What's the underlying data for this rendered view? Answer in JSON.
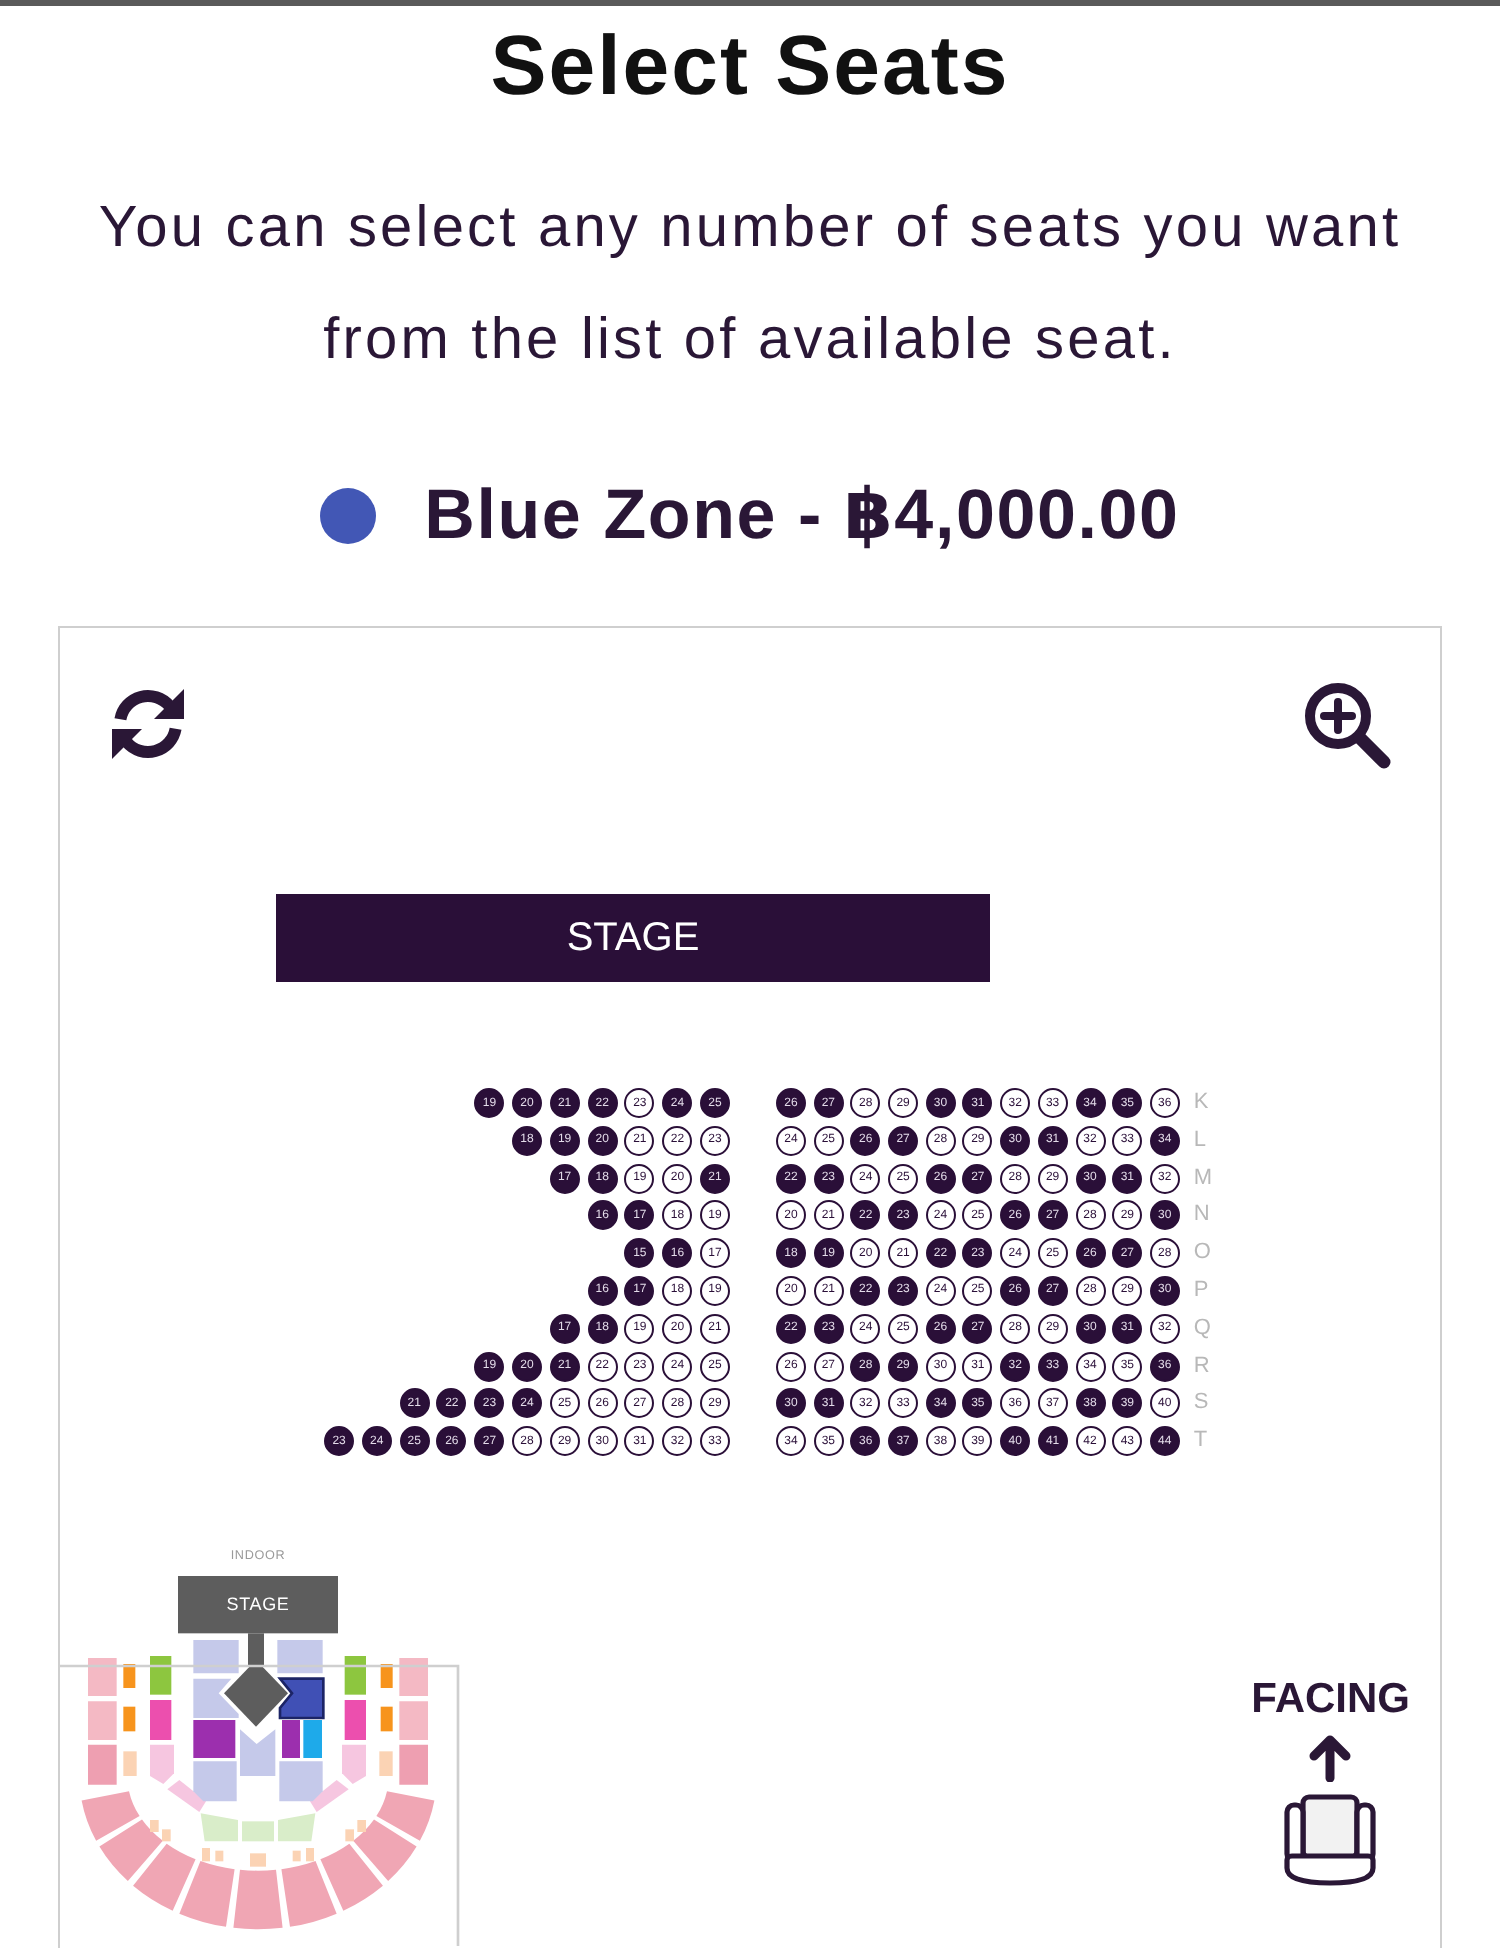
{
  "title": "Select Seats",
  "description": "You can select any number of seats you want from the list of available seat.",
  "zone": {
    "name": "Blue Zone - ฿4,000.00",
    "color": "#4257b5"
  },
  "seat_map": {
    "stage": "STAGE",
    "rows": [
      {
        "row": "K",
        "left": [
          {
            "number": "19",
            "filled": true
          },
          {
            "number": "20",
            "filled": true
          },
          {
            "number": "21",
            "filled": true
          },
          {
            "number": "22",
            "filled": true
          },
          {
            "number": "23",
            "filled": false
          },
          {
            "number": "24",
            "filled": true
          },
          {
            "number": "25",
            "filled": true
          }
        ],
        "right": [
          {
            "number": "26",
            "filled": true
          },
          {
            "number": "27",
            "filled": true
          },
          {
            "number": "28",
            "filled": false
          },
          {
            "number": "29",
            "filled": false
          },
          {
            "number": "30",
            "filled": true
          },
          {
            "number": "31",
            "filled": true
          },
          {
            "number": "32",
            "filled": false
          },
          {
            "number": "33",
            "filled": false
          },
          {
            "number": "34",
            "filled": true
          },
          {
            "number": "35",
            "filled": true
          },
          {
            "number": "36",
            "filled": false
          }
        ]
      },
      {
        "row": "L",
        "left": [
          {
            "number": "18",
            "filled": true
          },
          {
            "number": "19",
            "filled": true
          },
          {
            "number": "20",
            "filled": true
          },
          {
            "number": "21",
            "filled": false
          },
          {
            "number": "22",
            "filled": false
          },
          {
            "number": "23",
            "filled": false
          }
        ],
        "right": [
          {
            "number": "24",
            "filled": false
          },
          {
            "number": "25",
            "filled": false
          },
          {
            "number": "26",
            "filled": true
          },
          {
            "number": "27",
            "filled": true
          },
          {
            "number": "28",
            "filled": false
          },
          {
            "number": "29",
            "filled": false
          },
          {
            "number": "30",
            "filled": true
          },
          {
            "number": "31",
            "filled": true
          },
          {
            "number": "32",
            "filled": false
          },
          {
            "number": "33",
            "filled": false
          },
          {
            "number": "34",
            "filled": true
          }
        ]
      },
      {
        "row": "M",
        "left": [
          {
            "number": "17",
            "filled": true
          },
          {
            "number": "18",
            "filled": true
          },
          {
            "number": "19",
            "filled": false
          },
          {
            "number": "20",
            "filled": false
          },
          {
            "number": "21",
            "filled": true
          }
        ],
        "right": [
          {
            "number": "22",
            "filled": true
          },
          {
            "number": "23",
            "filled": true
          },
          {
            "number": "24",
            "filled": false
          },
          {
            "number": "25",
            "filled": false
          },
          {
            "number": "26",
            "filled": true
          },
          {
            "number": "27",
            "filled": true
          },
          {
            "number": "28",
            "filled": false
          },
          {
            "number": "29",
            "filled": false
          },
          {
            "number": "30",
            "filled": true
          },
          {
            "number": "31",
            "filled": true
          },
          {
            "number": "32",
            "filled": false
          }
        ]
      },
      {
        "row": "N",
        "left": [
          {
            "number": "16",
            "filled": true
          },
          {
            "number": "17",
            "filled": true
          },
          {
            "number": "18",
            "filled": false
          },
          {
            "number": "19",
            "filled": false
          }
        ],
        "right": [
          {
            "number": "20",
            "filled": false
          },
          {
            "number": "21",
            "filled": false
          },
          {
            "number": "22",
            "filled": true
          },
          {
            "number": "23",
            "filled": true
          },
          {
            "number": "24",
            "filled": false
          },
          {
            "number": "25",
            "filled": false
          },
          {
            "number": "26",
            "filled": true
          },
          {
            "number": "27",
            "filled": true
          },
          {
            "number": "28",
            "filled": false
          },
          {
            "number": "29",
            "filled": false
          },
          {
            "number": "30",
            "filled": true
          }
        ]
      },
      {
        "row": "O",
        "left": [
          {
            "number": "15",
            "filled": true
          },
          {
            "number": "16",
            "filled": true
          },
          {
            "number": "17",
            "filled": false
          }
        ],
        "right": [
          {
            "number": "18",
            "filled": true
          },
          {
            "number": "19",
            "filled": true
          },
          {
            "number": "20",
            "filled": false
          },
          {
            "number": "21",
            "filled": false
          },
          {
            "number": "22",
            "filled": true
          },
          {
            "number": "23",
            "filled": true
          },
          {
            "number": "24",
            "filled": false
          },
          {
            "number": "25",
            "filled": false
          },
          {
            "number": "26",
            "filled": true
          },
          {
            "number": "27",
            "filled": true
          },
          {
            "number": "28",
            "filled": false
          }
        ]
      },
      {
        "row": "P",
        "left": [
          {
            "number": "16",
            "filled": true
          },
          {
            "number": "17",
            "filled": true
          },
          {
            "number": "18",
            "filled": false
          },
          {
            "number": "19",
            "filled": false
          }
        ],
        "right": [
          {
            "number": "20",
            "filled": false
          },
          {
            "number": "21",
            "filled": false
          },
          {
            "number": "22",
            "filled": true
          },
          {
            "number": "23",
            "filled": true
          },
          {
            "number": "24",
            "filled": false
          },
          {
            "number": "25",
            "filled": false
          },
          {
            "number": "26",
            "filled": true
          },
          {
            "number": "27",
            "filled": true
          },
          {
            "number": "28",
            "filled": false
          },
          {
            "number": "29",
            "filled": false
          },
          {
            "number": "30",
            "filled": true
          }
        ]
      },
      {
        "row": "Q",
        "left": [
          {
            "number": "17",
            "filled": true
          },
          {
            "number": "18",
            "filled": true
          },
          {
            "number": "19",
            "filled": false
          },
          {
            "number": "20",
            "filled": false
          },
          {
            "number": "21",
            "filled": false
          }
        ],
        "right": [
          {
            "number": "22",
            "filled": true
          },
          {
            "number": "23",
            "filled": true
          },
          {
            "number": "24",
            "filled": false
          },
          {
            "number": "25",
            "filled": false
          },
          {
            "number": "26",
            "filled": true
          },
          {
            "number": "27",
            "filled": true
          },
          {
            "number": "28",
            "filled": false
          },
          {
            "number": "29",
            "filled": false
          },
          {
            "number": "30",
            "filled": true
          },
          {
            "number": "31",
            "filled": true
          },
          {
            "number": "32",
            "filled": false
          }
        ]
      },
      {
        "row": "R",
        "left": [
          {
            "number": "19",
            "filled": true
          },
          {
            "number": "20",
            "filled": true
          },
          {
            "number": "21",
            "filled": true
          },
          {
            "number": "22",
            "filled": false
          },
          {
            "number": "23",
            "filled": false
          },
          {
            "number": "24",
            "filled": false
          },
          {
            "number": "25",
            "filled": false
          }
        ],
        "right": [
          {
            "number": "26",
            "filled": false
          },
          {
            "number": "27",
            "filled": false
          },
          {
            "number": "28",
            "filled": true
          },
          {
            "number": "29",
            "filled": true
          },
          {
            "number": "30",
            "filled": false
          },
          {
            "number": "31",
            "filled": false
          },
          {
            "number": "32",
            "filled": true
          },
          {
            "number": "33",
            "filled": true
          },
          {
            "number": "34",
            "filled": false
          },
          {
            "number": "35",
            "filled": false
          },
          {
            "number": "36",
            "filled": true
          }
        ]
      },
      {
        "row": "S",
        "left": [
          {
            "number": "21",
            "filled": true
          },
          {
            "number": "22",
            "filled": true
          },
          {
            "number": "23",
            "filled": true
          },
          {
            "number": "24",
            "filled": true
          },
          {
            "number": "25",
            "filled": false
          },
          {
            "number": "26",
            "filled": false
          },
          {
            "number": "27",
            "filled": false
          },
          {
            "number": "28",
            "filled": false
          },
          {
            "number": "29",
            "filled": false
          }
        ],
        "right": [
          {
            "number": "30",
            "filled": true
          },
          {
            "number": "31",
            "filled": true
          },
          {
            "number": "32",
            "filled": false
          },
          {
            "number": "33",
            "filled": false
          },
          {
            "number": "34",
            "filled": true
          },
          {
            "number": "35",
            "filled": true
          },
          {
            "number": "36",
            "filled": false
          },
          {
            "number": "37",
            "filled": false
          },
          {
            "number": "38",
            "filled": true
          },
          {
            "number": "39",
            "filled": true
          },
          {
            "number": "40",
            "filled": false
          }
        ]
      },
      {
        "row": "T",
        "left": [
          {
            "number": "23",
            "filled": true
          },
          {
            "number": "24",
            "filled": true
          },
          {
            "number": "25",
            "filled": true
          },
          {
            "number": "26",
            "filled": true
          },
          {
            "number": "27",
            "filled": true
          },
          {
            "number": "28",
            "filled": false
          },
          {
            "number": "29",
            "filled": false
          },
          {
            "number": "30",
            "filled": false
          },
          {
            "number": "31",
            "filled": false
          },
          {
            "number": "32",
            "filled": false
          },
          {
            "number": "33",
            "filled": false
          }
        ],
        "right": [
          {
            "number": "34",
            "filled": false
          },
          {
            "number": "35",
            "filled": false
          },
          {
            "number": "36",
            "filled": true
          },
          {
            "number": "37",
            "filled": true
          },
          {
            "number": "38",
            "filled": false
          },
          {
            "number": "39",
            "filled": false
          },
          {
            "number": "40",
            "filled": true
          },
          {
            "number": "41",
            "filled": true
          },
          {
            "number": "42",
            "filled": false
          },
          {
            "number": "43",
            "filled": false
          },
          {
            "number": "44",
            "filled": true
          }
        ]
      }
    ]
  },
  "minimap": {
    "venue_label": "INDOOR",
    "stage": "STAGE"
  },
  "facing": {
    "label": "FACING"
  }
}
